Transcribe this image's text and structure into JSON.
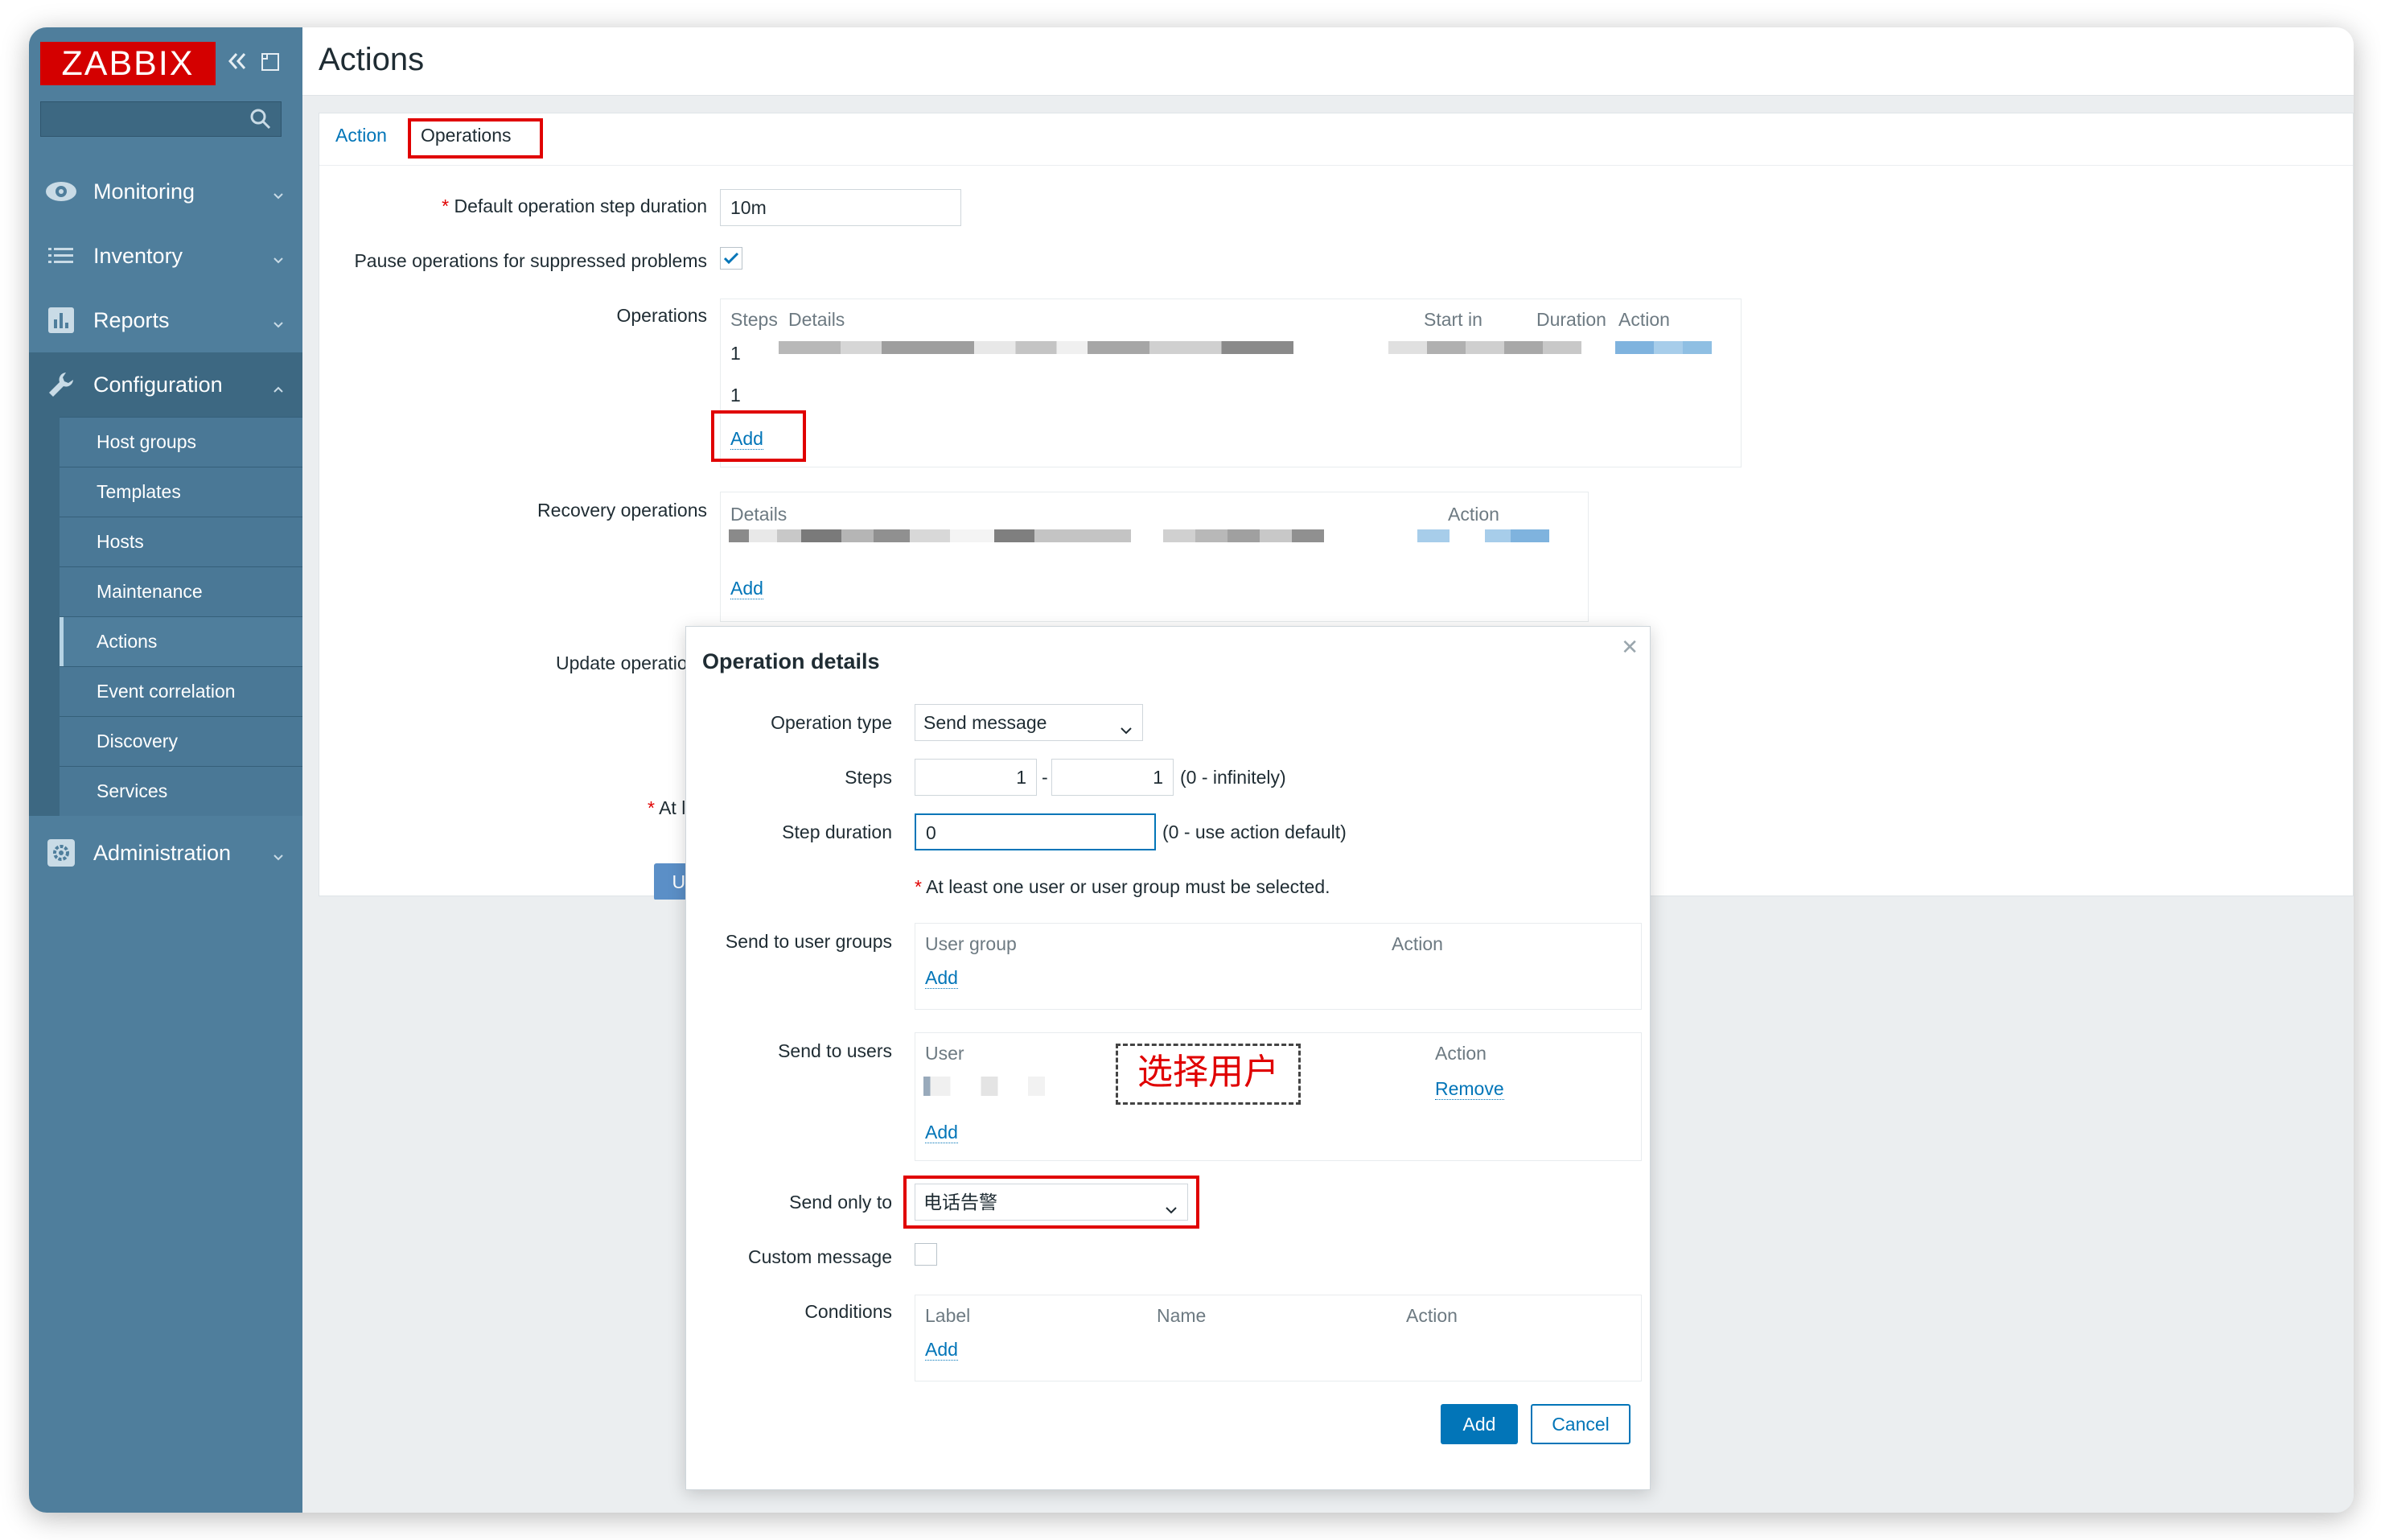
{
  "sidebar": {
    "logo": "ZABBIX",
    "menu": {
      "monitoring": "Monitoring",
      "inventory": "Inventory",
      "reports": "Reports",
      "configuration": "Configuration",
      "administration": "Administration"
    },
    "config_items": [
      "Host groups",
      "Templates",
      "Hosts",
      "Maintenance",
      "Actions",
      "Event correlation",
      "Discovery",
      "Services"
    ]
  },
  "page": {
    "title": "Actions"
  },
  "tabs": {
    "action": "Action",
    "operations": "Operations"
  },
  "form": {
    "default_step_label": "Default operation step duration",
    "default_step_value": "10m",
    "pause_label": "Pause operations for suppressed problems",
    "operations_label": "Operations",
    "operations_table": {
      "headers": {
        "steps": "Steps",
        "details": "Details",
        "start_in": "Start in",
        "duration": "Duration",
        "action": "Action"
      },
      "rows": [
        "1",
        "1"
      ],
      "add": "Add"
    },
    "recovery_label": "Recovery operations",
    "recovery_table": {
      "details": "Details",
      "action": "Action",
      "add": "Add"
    },
    "update_label": "Update operations",
    "at_least_partial": "At lea",
    "update_button_partial": "Upda"
  },
  "dialog": {
    "title": "Operation details",
    "op_type_label": "Operation type",
    "op_type_value": "Send message",
    "steps_label": "Steps",
    "steps_from": "1",
    "steps_dash": "-",
    "steps_to": "1",
    "steps_hint": "(0 - infinitely)",
    "step_duration_label": "Step duration",
    "step_duration_value": "0",
    "step_duration_hint": "(0 - use action default)",
    "required_note": "At least one user or user group must be selected.",
    "user_groups_label": "Send to user groups",
    "user_groups_table": {
      "user_group": "User group",
      "action": "Action",
      "add": "Add"
    },
    "users_label": "Send to users",
    "users_table": {
      "user": "User",
      "action": "Action",
      "remove": "Remove",
      "add": "Add"
    },
    "annotation": "选择用户",
    "send_only_label": "Send only to",
    "send_only_value": "电话告警",
    "custom_message_label": "Custom message",
    "conditions_label": "Conditions",
    "conditions_table": {
      "label": "Label",
      "name": "Name",
      "action": "Action",
      "add": "Add"
    },
    "add_button": "Add",
    "cancel_button": "Cancel"
  },
  "colors": {
    "sidebar": "#4f7e9c",
    "logo": "#d40000",
    "accent": "#0275b8",
    "highlight": "#e00000"
  }
}
